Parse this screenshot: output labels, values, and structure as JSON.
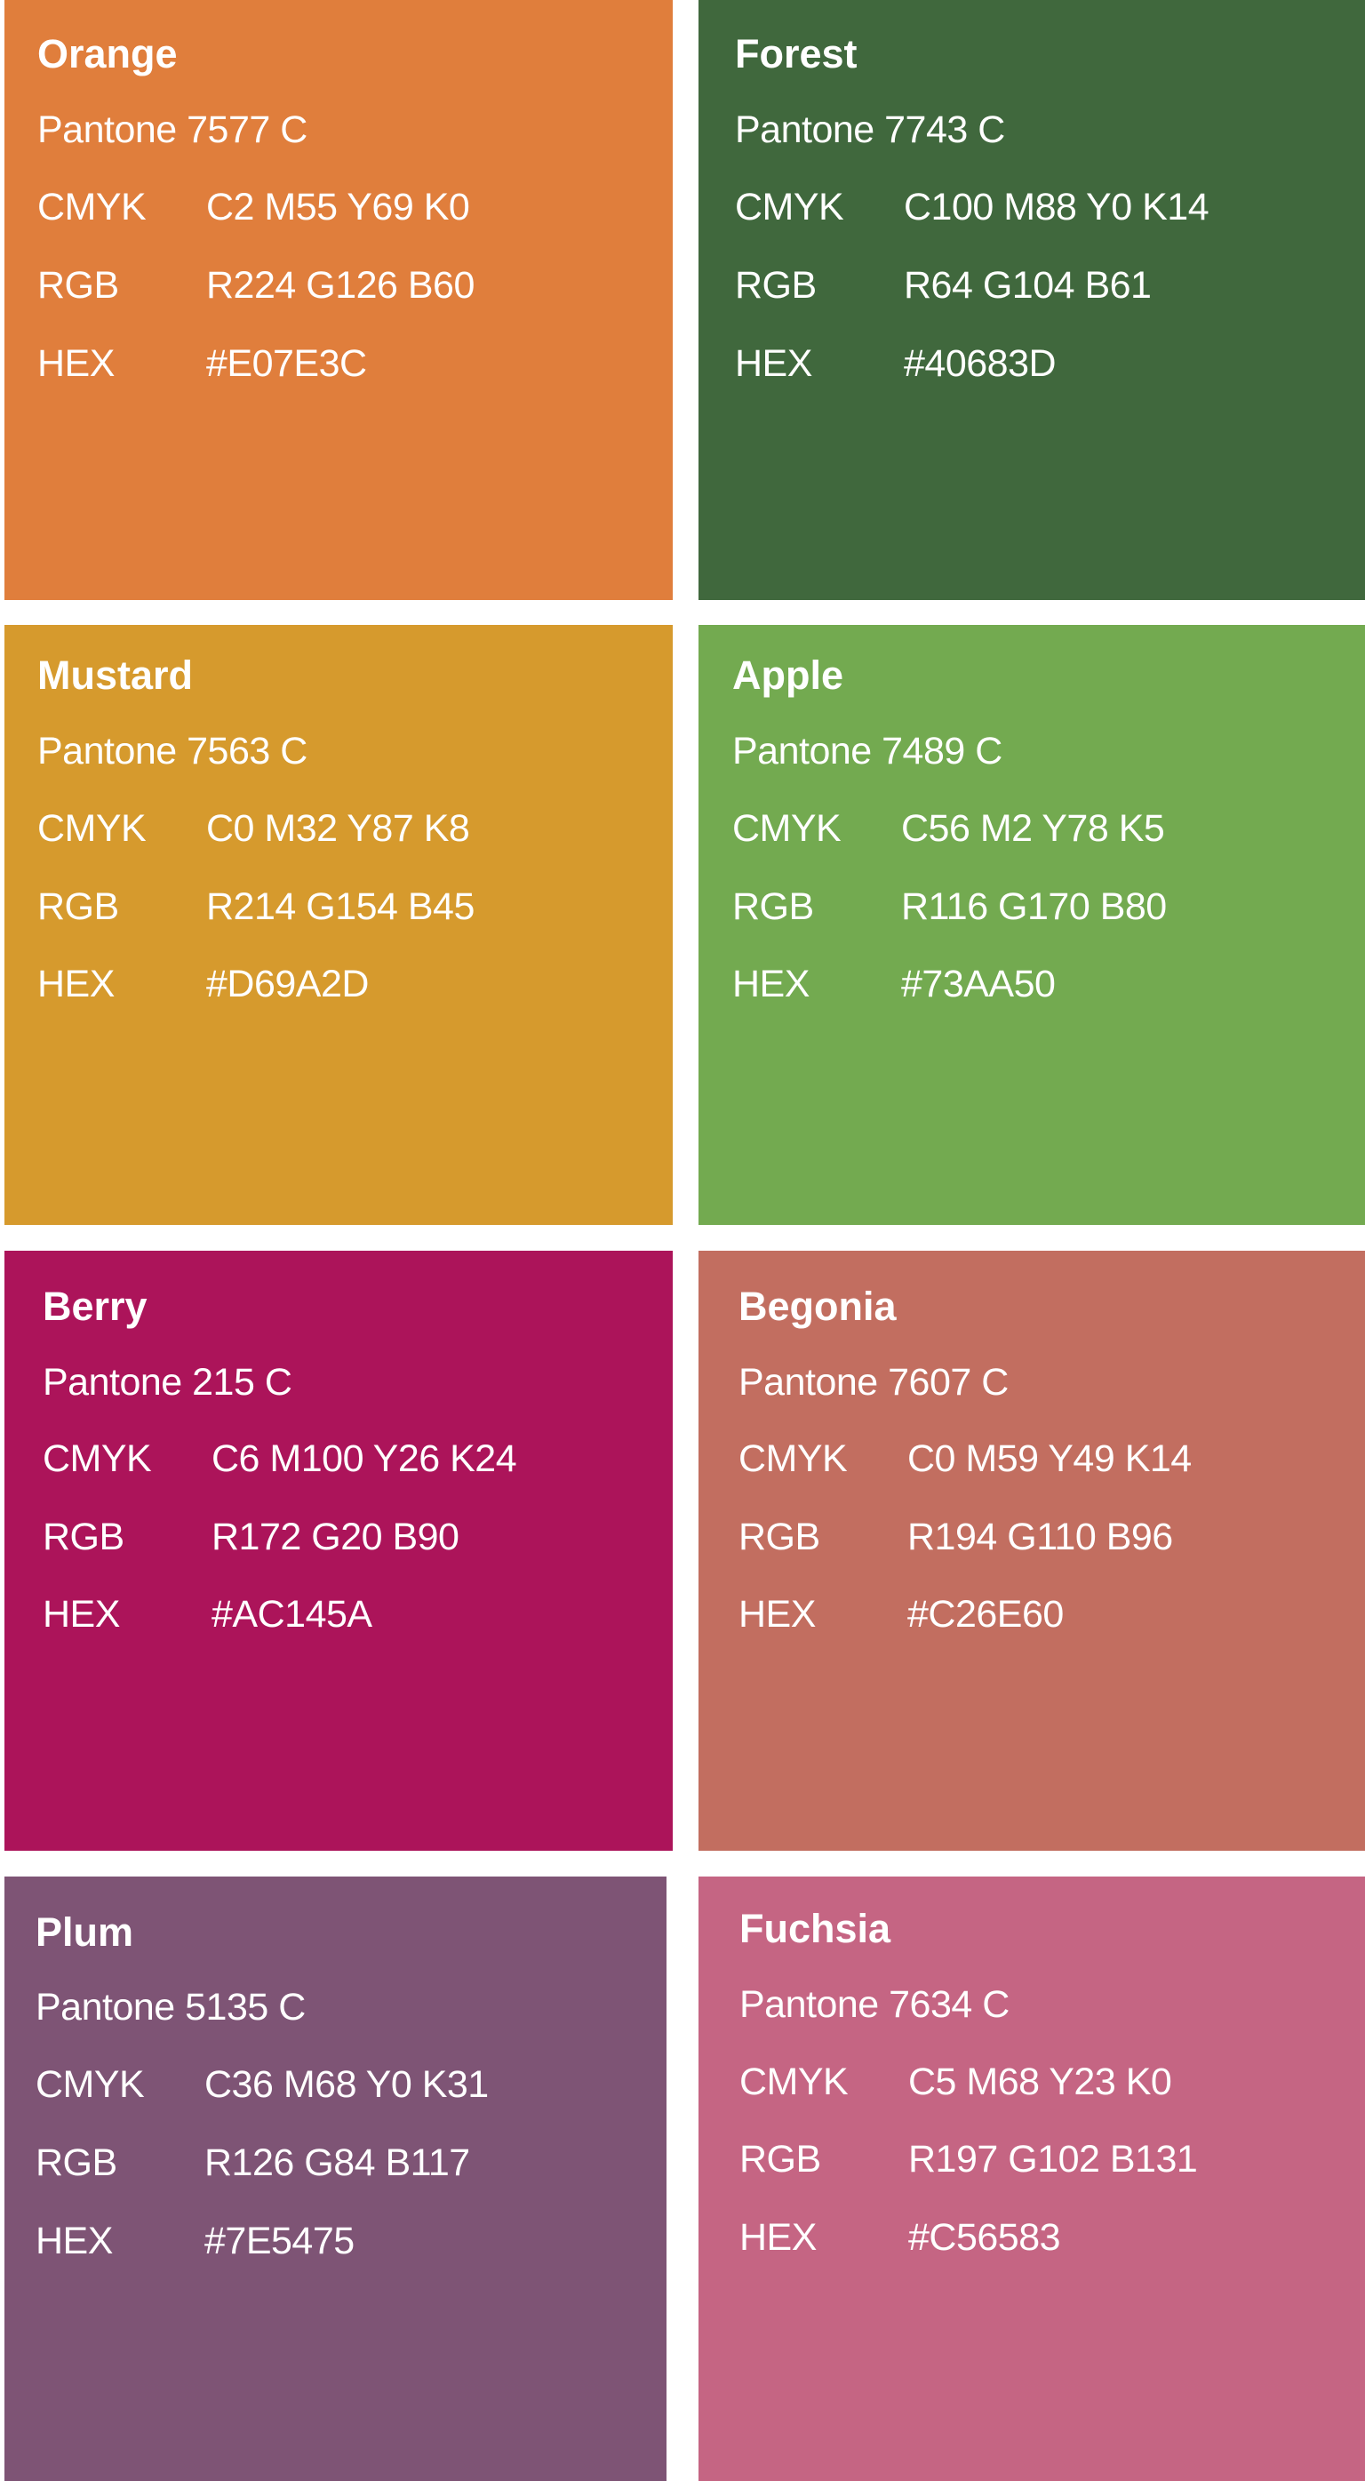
{
  "swatches": [
    {
      "name": "Orange",
      "pantone": "Pantone 7577 C",
      "cmyk_label": "CMYK",
      "cmyk": "C2 M55 Y69 K0",
      "rgb_label": "RGB",
      "rgb": "R224 G126 B60",
      "hex_label": "HEX",
      "hex": "#E07E3C",
      "color": "#E07E3C"
    },
    {
      "name": "Forest",
      "pantone": "Pantone 7743 C",
      "cmyk_label": "CMYK",
      "cmyk": "C100 M88 Y0 K14",
      "rgb_label": "RGB",
      "rgb": "R64 G104 B61",
      "hex_label": "HEX",
      "hex": "#40683D",
      "color": "#40683D"
    },
    {
      "name": "Mustard",
      "pantone": "Pantone 7563 C",
      "cmyk_label": "CMYK",
      "cmyk": "C0 M32 Y87 K8",
      "rgb_label": "RGB",
      "rgb": "R214 G154 B45",
      "hex_label": "HEX",
      "hex": "#D69A2D",
      "color": "#D69A2D"
    },
    {
      "name": "Apple",
      "pantone": "Pantone 7489 C",
      "cmyk_label": "CMYK",
      "cmyk": "C56 M2 Y78 K5",
      "rgb_label": "RGB",
      "rgb": "R116 G170 B80",
      "hex_label": "HEX",
      "hex": "#73AA50",
      "color": "#73AA50"
    },
    {
      "name": "Berry",
      "pantone": "Pantone 215 C",
      "cmyk_label": "CMYK",
      "cmyk": "C6 M100 Y26 K24",
      "rgb_label": "RGB",
      "rgb": "R172 G20 B90",
      "hex_label": "HEX",
      "hex": "#AC145A",
      "color": "#AC145A"
    },
    {
      "name": "Begonia",
      "pantone": "Pantone 7607 C",
      "cmyk_label": "CMYK",
      "cmyk": "C0 M59 Y49 K14",
      "rgb_label": "RGB",
      "rgb": "R194 G110 B96",
      "hex_label": "HEX",
      "hex": "#C26E60",
      "color": "#C26E60"
    },
    {
      "name": "Plum",
      "pantone": "Pantone 5135 C",
      "cmyk_label": "CMYK",
      "cmyk": "C36 M68 Y0 K31",
      "rgb_label": "RGB",
      "rgb": "R126 G84 B117",
      "hex_label": "HEX",
      "hex": "#7E5475",
      "color": "#7E5475"
    },
    {
      "name": "Fuchsia",
      "pantone": "Pantone 7634 C",
      "cmyk_label": "CMYK",
      "cmyk": "C5 M68 Y23 K0",
      "rgb_label": "RGB",
      "rgb": "R197 G102 B131",
      "hex_label": "HEX",
      "hex": "#C56583",
      "color": "#C56583"
    }
  ]
}
